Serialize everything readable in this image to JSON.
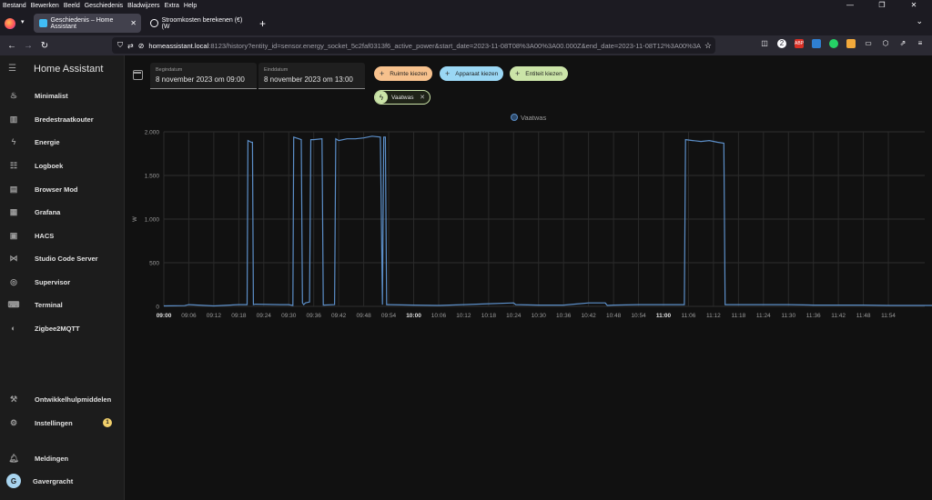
{
  "browser": {
    "menu": [
      "Bestand",
      "Bewerken",
      "Beeld",
      "Geschiedenis",
      "Bladwijzers",
      "Extra",
      "Help"
    ],
    "tabs": [
      {
        "label": "Geschiedenis – Home Assistant",
        "active": true
      },
      {
        "label": "Stroomkosten berekenen (€) (W",
        "active": false
      }
    ],
    "url_host": "homeassistant.local",
    "url_rest": ":8123/history?entity_id=sensor.energy_socket_5c2faf0313f6_active_power&start_date=2023-11-08T08%3A00%3A00.000Z&end_date=2023-11-08T12%3A00%3A",
    "addon_badge": "2"
  },
  "sidebar": {
    "title": "Home Assistant",
    "items": [
      {
        "label": "Minimalist",
        "icon": "brain-icon"
      },
      {
        "label": "Bredestraatkouter",
        "icon": "office-building-icon"
      },
      {
        "label": "Energie",
        "icon": "lightning-bolt-icon"
      },
      {
        "label": "Logboek",
        "icon": "format-list-bulleted-icon"
      },
      {
        "label": "Browser Mod",
        "icon": "server-icon"
      },
      {
        "label": "Grafana",
        "icon": "chart-box-icon"
      },
      {
        "label": "HACS",
        "icon": "hacs-icon"
      },
      {
        "label": "Studio Code Server",
        "icon": "vscode-icon"
      },
      {
        "label": "Supervisor",
        "icon": "supervisor-icon"
      },
      {
        "label": "Terminal",
        "icon": "console-icon"
      },
      {
        "label": "Zigbee2MQTT",
        "icon": "zigbee-icon"
      }
    ],
    "bottom": [
      {
        "label": "Ontwikkelhulpmiddelen",
        "icon": "hammer-icon"
      },
      {
        "label": "Instellingen",
        "icon": "cog-icon",
        "badge": "1"
      },
      {
        "label": "Meldingen",
        "icon": "bell-icon"
      },
      {
        "label": "Gavergracht",
        "avatar": "G"
      }
    ]
  },
  "history": {
    "start_label": "Begindatum",
    "start_value": "8 november 2023 om 09:00",
    "end_label": "Einddatum",
    "end_value": "8 november 2023 om 13:00",
    "add_area": "Ruimte kiezen",
    "add_device": "Apparaat kiezen",
    "add_entity": "Entiteit kiezen",
    "selected_entity": "Vaatwas"
  },
  "chart_data": {
    "type": "line",
    "legend": [
      "Vaatwas"
    ],
    "ylabel": "W",
    "ylim": [
      0,
      2000
    ],
    "yticks": [
      "0",
      "500",
      "1.000",
      "1.500",
      "2.000"
    ],
    "xticks": [
      "09:00",
      "09:06",
      "09:12",
      "09:18",
      "09:24",
      "09:30",
      "09:36",
      "09:42",
      "09:48",
      "09:54",
      "10:00",
      "10:06",
      "10:12",
      "10:18",
      "10:24",
      "10:30",
      "10:36",
      "10:42",
      "10:48",
      "10:54",
      "11:00",
      "11:06",
      "11:12",
      "11:18",
      "11:24",
      "11:30",
      "11:36",
      "11:42",
      "11:48",
      "11:54"
    ],
    "xticks_bold": [
      "09:00",
      "10:00",
      "11:00"
    ],
    "series": [
      {
        "name": "Vaatwas",
        "color": "#5c8fc9",
        "x_minutes": [
          0,
          5,
          6,
          12,
          18,
          20,
          20.2,
          21,
          21.3,
          21.5,
          22,
          28,
          30,
          31,
          31.2,
          33,
          33.3,
          33.6,
          34,
          35,
          35.3,
          36,
          38,
          38.3,
          41,
          41.3,
          42,
          44,
          46,
          48,
          50,
          52,
          52.5,
          52.8,
          53.2,
          53.5,
          54,
          60,
          66,
          72,
          78,
          84,
          84.5,
          90,
          96,
          102,
          106,
          106.5,
          108,
          114,
          119,
          125,
          125.3,
          127,
          129,
          131,
          133,
          134.5,
          134.8,
          135.5,
          140,
          145,
          150,
          156,
          162,
          168,
          174,
          180,
          185
        ],
        "values": [
          5,
          8,
          20,
          5,
          20,
          20,
          1900,
          1880,
          1880,
          20,
          25,
          20,
          20,
          10,
          1940,
          1910,
          40,
          20,
          40,
          50,
          1910,
          1910,
          1920,
          15,
          20,
          1920,
          1900,
          1920,
          1920,
          1930,
          1950,
          1940,
          20,
          1940,
          1940,
          20,
          20,
          15,
          10,
          20,
          30,
          40,
          20,
          15,
          15,
          40,
          40,
          10,
          15,
          20,
          20,
          20,
          1910,
          1900,
          1890,
          1900,
          1880,
          1870,
          20,
          20,
          20,
          20,
          20,
          15,
          15,
          15,
          10,
          10,
          10
        ]
      }
    ]
  }
}
